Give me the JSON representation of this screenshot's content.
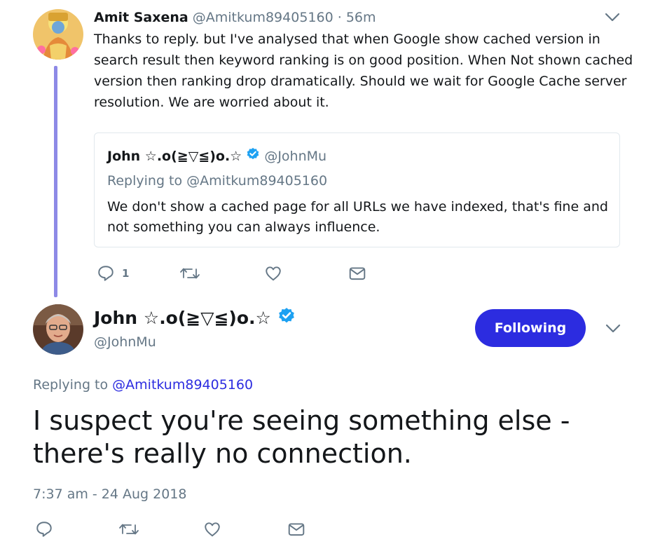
{
  "reply_tweet": {
    "author_name": "Amit Saxena",
    "handle": "@Amitkum89405160",
    "time": "· 56m",
    "text_lines": [
      "Thanks to reply.  but I've analysed that when Google show cached version in",
      "search result then keyword ranking is on good position. When Not shown cached",
      "version then ranking drop dramatically.  Should we wait for Google Cache server",
      "resolution. We are worried about it."
    ],
    "reply_count": "1",
    "quoted": {
      "author_name": "John ☆.o(≧▽≦)o.☆",
      "handle": "@JohnMu",
      "replying_to": "Replying to @Amitkum89405160",
      "text_lines": [
        "We don't show a cached page for all URLs we have indexed, that's fine and",
        "not something you can always influence."
      ]
    }
  },
  "main_tweet": {
    "author_name": "John ☆.o(≧▽≦)o.☆",
    "handle": "@JohnMu",
    "follow_label": "Following",
    "replying_prefix": "Replying to ",
    "replying_handle": "@Amitkum89405160",
    "text_lines": [
      "I suspect you're seeing something else -",
      "there's really no connection."
    ],
    "timestamp": "7:37 am - 24 Aug 2018"
  },
  "colors": {
    "accent": "#2c2ce0",
    "verified": "#1da1f2",
    "thread_line": "#8d89e6",
    "secondary_text": "#657786"
  },
  "icons": [
    "reply-icon",
    "retweet-icon",
    "like-icon",
    "dm-icon",
    "chevron-down-icon",
    "verified-badge-icon"
  ]
}
